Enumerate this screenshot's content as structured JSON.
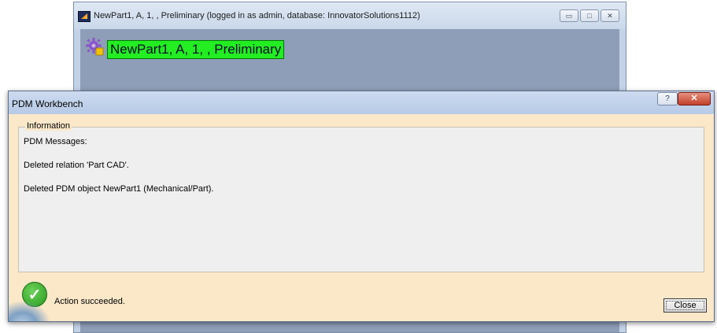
{
  "background_window": {
    "title": "NewPart1, A, 1, , Preliminary (logged in as admin, database: InnovatorSolutions1112)",
    "minimize_glyph": "▭",
    "maximize_glyph": "□",
    "close_glyph": "✕",
    "tree_node_label": "NewPart1, A, 1, , Preliminary",
    "node_icon": "gear-icon"
  },
  "dialog": {
    "title": "PDM Workbench",
    "help_glyph": "?",
    "close_glyph": "✕",
    "group_label": "Information",
    "messages": [
      "PDM Messages:",
      "Deleted relation 'Part CAD'.",
      "Deleted PDM object NewPart1 (Mechanical/Part)."
    ],
    "status_icon": "check-circle-icon",
    "status_glyph": "✓",
    "status_text": "Action succeeded.",
    "close_button_label": "Close"
  },
  "colors": {
    "dialog_background": "#fbe8c9",
    "node_highlight": "#22ee22",
    "success_green": "#2fae26"
  }
}
